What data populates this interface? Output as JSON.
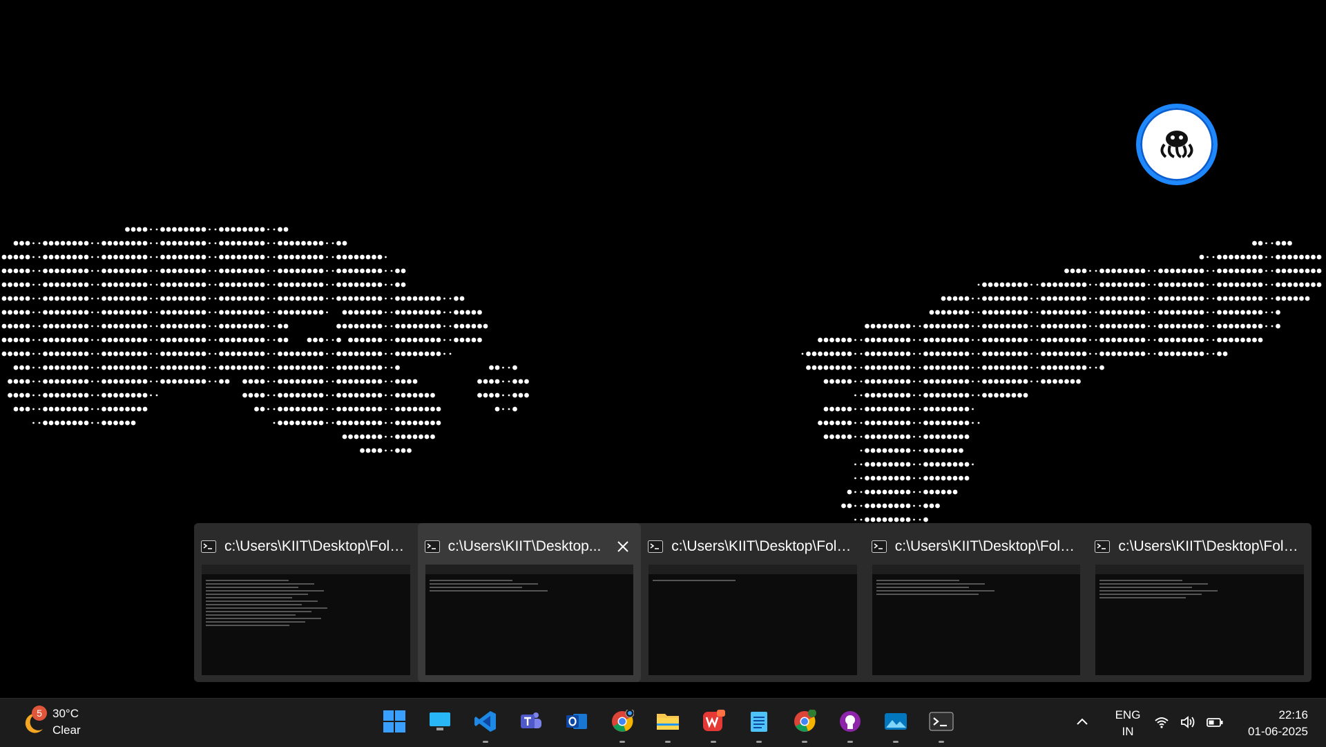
{
  "desktop": {
    "wallpaper": "dotted-world-map",
    "floating_widget_icon": "octopus-icon"
  },
  "previews": [
    {
      "title": "c:\\Users\\KIIT\\Desktop\\Folde...",
      "icon": "terminal-icon",
      "active": false
    },
    {
      "title": "c:\\Users\\KIIT\\Desktop...",
      "icon": "terminal-icon",
      "active": true
    },
    {
      "title": "c:\\Users\\KIIT\\Desktop\\Folde...",
      "icon": "terminal-icon",
      "active": false
    },
    {
      "title": "c:\\Users\\KIIT\\Desktop\\Folde...",
      "icon": "terminal-icon",
      "active": false
    },
    {
      "title": "c:\\Users\\KIIT\\Desktop\\Folde...",
      "icon": "terminal-icon",
      "active": false
    }
  ],
  "taskbar": {
    "weather": {
      "temperature": "30°C",
      "condition": "Clear",
      "badge": "5"
    },
    "apps": [
      {
        "name": "start-icon",
        "running": false
      },
      {
        "name": "desktop-icon",
        "running": false
      },
      {
        "name": "vscode-icon",
        "running": true
      },
      {
        "name": "teams-icon",
        "running": false
      },
      {
        "name": "outlook-icon",
        "running": false
      },
      {
        "name": "chrome-icon",
        "running": true
      },
      {
        "name": "file-explorer-icon",
        "running": true
      },
      {
        "name": "wps-office-icon",
        "running": true
      },
      {
        "name": "notepad-icon",
        "running": true
      },
      {
        "name": "chrome-profile-icon",
        "running": true
      },
      {
        "name": "github-desktop-icon",
        "running": true
      },
      {
        "name": "photos-icon",
        "running": true
      },
      {
        "name": "terminal-icon",
        "running": true
      }
    ],
    "language": {
      "line1": "ENG",
      "line2": "IN"
    },
    "clock": {
      "time": "22:16",
      "date": "01-06-2025"
    }
  },
  "colors": {
    "accent": "#1e88ff",
    "taskbar_bg": "#1c1c1c",
    "preview_bg": "#2b2b2b"
  }
}
